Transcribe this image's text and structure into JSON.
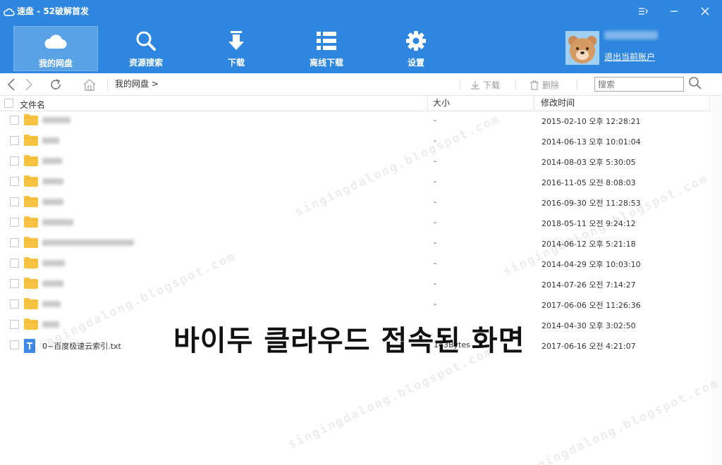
{
  "app": {
    "title": "速盘 - 52破解首发",
    "colors": {
      "header": "#2e86de",
      "nav_active": "#5aa2e6",
      "folder": "#f6c343",
      "txt_icon": "#3d8be6"
    }
  },
  "window": {
    "settings_icon": "menu-settings-icon",
    "min_icon": "minimize-icon",
    "close_icon": "close-icon"
  },
  "nav": {
    "items": [
      {
        "label": "我的网盘",
        "icon": "cloud-icon",
        "active": true
      },
      {
        "label": "资源搜索",
        "icon": "search-icon",
        "active": false
      },
      {
        "label": "下载",
        "icon": "download-icon",
        "active": false
      },
      {
        "label": "离线下载",
        "icon": "list-icon",
        "active": false
      },
      {
        "label": "设置",
        "icon": "gear-icon",
        "active": false
      }
    ]
  },
  "account": {
    "logout": "退出当前账户"
  },
  "toolbar": {
    "breadcrumb": "我的网盘 >",
    "download": "下载",
    "delete": "删除",
    "search_placeholder": "搜索"
  },
  "columns": {
    "name": "文件名",
    "size": "大小",
    "time": "修改时间"
  },
  "files": [
    {
      "name": "",
      "type": "folder",
      "size": "-",
      "time": "2015-02-10 오후 12:28:21"
    },
    {
      "name": "",
      "type": "folder",
      "size": "-",
      "time": "2014-06-13 오후 10:01:04"
    },
    {
      "name": "",
      "type": "folder",
      "size": "-",
      "time": "2014-08-03 오후 5:30:05"
    },
    {
      "name": "",
      "type": "folder",
      "size": "-",
      "time": "2016-11-05 오전 8:08:03"
    },
    {
      "name": "",
      "type": "folder",
      "size": "-",
      "time": "2016-09-30 오전 11:28:53"
    },
    {
      "name": "",
      "type": "folder",
      "size": "-",
      "time": "2018-05-11 오전 9:24:12"
    },
    {
      "name": "",
      "type": "folder",
      "size": "-",
      "time": "2014-06-12 오후 5:21:18"
    },
    {
      "name": "",
      "type": "folder",
      "size": "-",
      "time": "2014-04-29 오후 10:03:10"
    },
    {
      "name": "",
      "type": "folder",
      "size": "-",
      "time": "2014-07-26 오전 7:14:27"
    },
    {
      "name": "",
      "type": "folder",
      "size": "-",
      "time": "2017-06-06 오전 11:26:36"
    },
    {
      "name": "",
      "type": "folder",
      "size": "",
      "time": "2014-04-30 오후 3:02:50"
    },
    {
      "name": "0~百度极速云索引.txt",
      "type": "txt",
      "size": "143Bytes",
      "time": "2017-06-16 오전 4:21:07"
    }
  ],
  "overlay_caption": "바이두 클라우드 접속된 화면",
  "watermark": "singingdalong.blogspot.com"
}
